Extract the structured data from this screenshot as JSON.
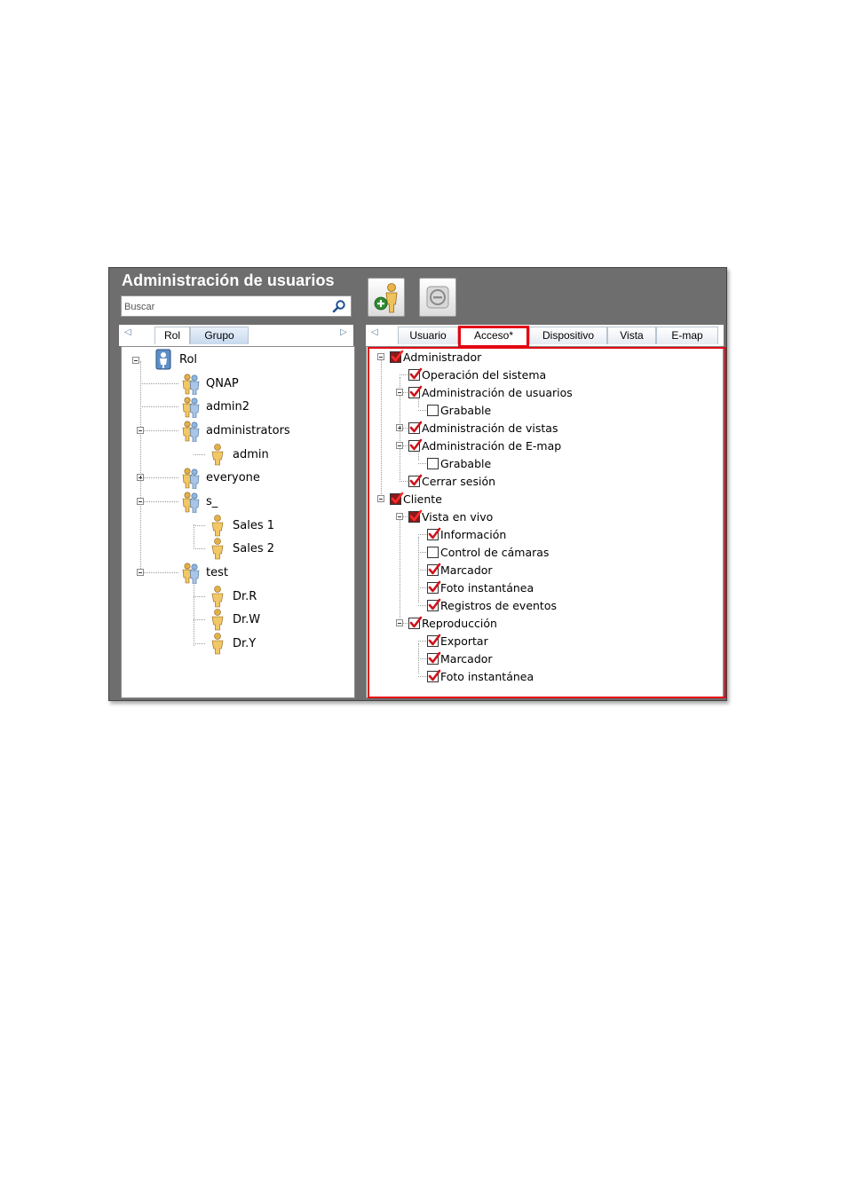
{
  "window": {
    "title": "Administración de usuarios",
    "search_placeholder": "Buscar"
  },
  "toolbar": {
    "add_icon": "add-user-icon",
    "remove_icon": "remove-icon"
  },
  "left_tabs": [
    {
      "label": "Rol",
      "active": true
    },
    {
      "label": "Grupo",
      "active": false
    }
  ],
  "right_tabs": [
    {
      "label": "Usuario"
    },
    {
      "label": "Acceso*",
      "active": true,
      "highlighted": true
    },
    {
      "label": "Dispositivo"
    },
    {
      "label": "Vista"
    },
    {
      "label": "E-map"
    }
  ],
  "role_tree": {
    "root": "Rol",
    "items": [
      "QNAP",
      "admin2",
      "administrators",
      "admin",
      "everyone",
      "s_",
      "Sales 1",
      "Sales 2",
      "test",
      "Dr.R",
      "Dr.W",
      "Dr.Y"
    ]
  },
  "permissions": [
    {
      "label": "Administrador",
      "state": "partial"
    },
    {
      "label": "Operación del sistema",
      "state": "checked"
    },
    {
      "label": "Administración de usuarios",
      "state": "checked"
    },
    {
      "label": "Grabable",
      "state": "unchecked"
    },
    {
      "label": "Administración de vistas",
      "state": "checked"
    },
    {
      "label": "Administración de E-map",
      "state": "checked"
    },
    {
      "label": "Grabable",
      "state": "unchecked"
    },
    {
      "label": "Cerrar sesión",
      "state": "checked"
    },
    {
      "label": "Cliente",
      "state": "partial"
    },
    {
      "label": "Vista en vivo",
      "state": "partial"
    },
    {
      "label": "Información",
      "state": "checked"
    },
    {
      "label": "Control de cámaras",
      "state": "unchecked"
    },
    {
      "label": "Marcador",
      "state": "checked"
    },
    {
      "label": "Foto instantánea",
      "state": "checked"
    },
    {
      "label": "Registros de eventos",
      "state": "checked"
    },
    {
      "label": "Reproducción",
      "state": "checked"
    },
    {
      "label": "Exportar",
      "state": "checked"
    },
    {
      "label": "Marcador",
      "state": "checked"
    },
    {
      "label": "Foto instantánea",
      "state": "checked"
    }
  ],
  "colors": {
    "titlebar": "#6e6e6e",
    "highlight": "#e30613",
    "check": "#d0121b"
  }
}
